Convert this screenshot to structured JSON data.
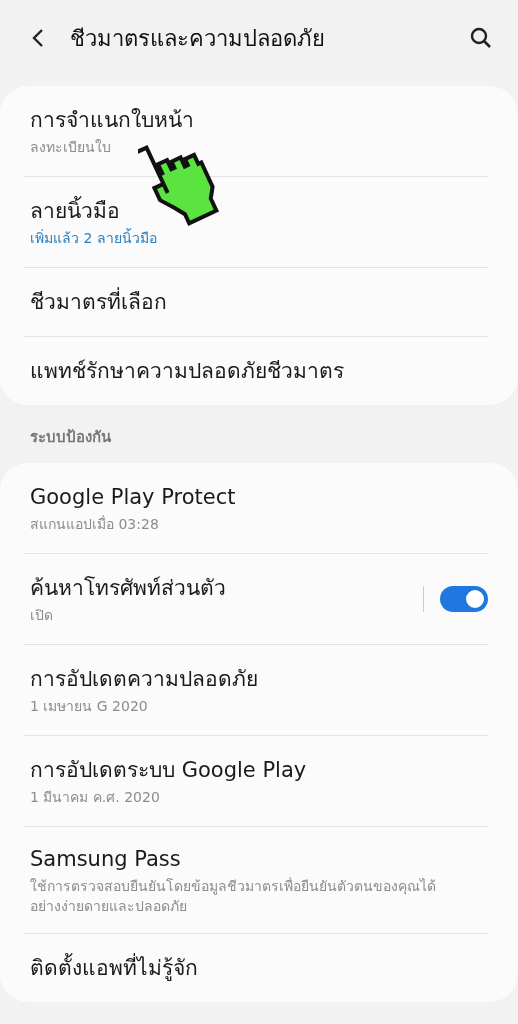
{
  "header": {
    "title": "ชีวมาตรและความปลอดภัย"
  },
  "sections": [
    {
      "items": [
        {
          "kind": "plain",
          "title": "การจำแนกใบหน้า",
          "subtitle": "ลงทะเบียนใบ",
          "subtitle_accent": false,
          "pointer": true
        },
        {
          "kind": "plain",
          "title": "ลายนิ้วมือ",
          "subtitle": "เพิ่มแล้ว 2 ลายนิ้วมือ",
          "subtitle_accent": true
        },
        {
          "kind": "plain",
          "title": "ชีวมาตรที่เลือก"
        },
        {
          "kind": "plain",
          "title": "แพทช์รักษาความปลอดภัยชีวมาตร"
        }
      ]
    },
    {
      "label": "ระบบป้องกัน",
      "items": [
        {
          "kind": "plain",
          "title": "Google Play Protect",
          "subtitle": "สแกนแอปเมื่อ 03:28",
          "subtitle_accent": false
        },
        {
          "kind": "toggle",
          "title": "ค้นหาโทรศัพท์ส่วนตัว",
          "subtitle": "เปิด",
          "subtitle_accent": false,
          "on": true
        },
        {
          "kind": "plain",
          "title": "การอัปเดตความปลอดภัย",
          "subtitle": "1 เมษายน G 2020",
          "subtitle_accent": false
        },
        {
          "kind": "plain",
          "title": "การอัปเดตระบบ Google Play",
          "subtitle": "1 มีนาคม ค.ศ. 2020",
          "subtitle_accent": false
        },
        {
          "kind": "plain",
          "title": "Samsung Pass",
          "subtitle": "ใช้การตรวจสอบยืนยันโดยข้อมูลชีวมาตรเพื่อยืนยันตัวตนของคุณได้อย่างง่ายดายและปลอดภัย",
          "subtitle_accent": false
        },
        {
          "kind": "plain",
          "title": "ติดตั้งแอพที่ไม่รู้จัก"
        }
      ]
    }
  ]
}
